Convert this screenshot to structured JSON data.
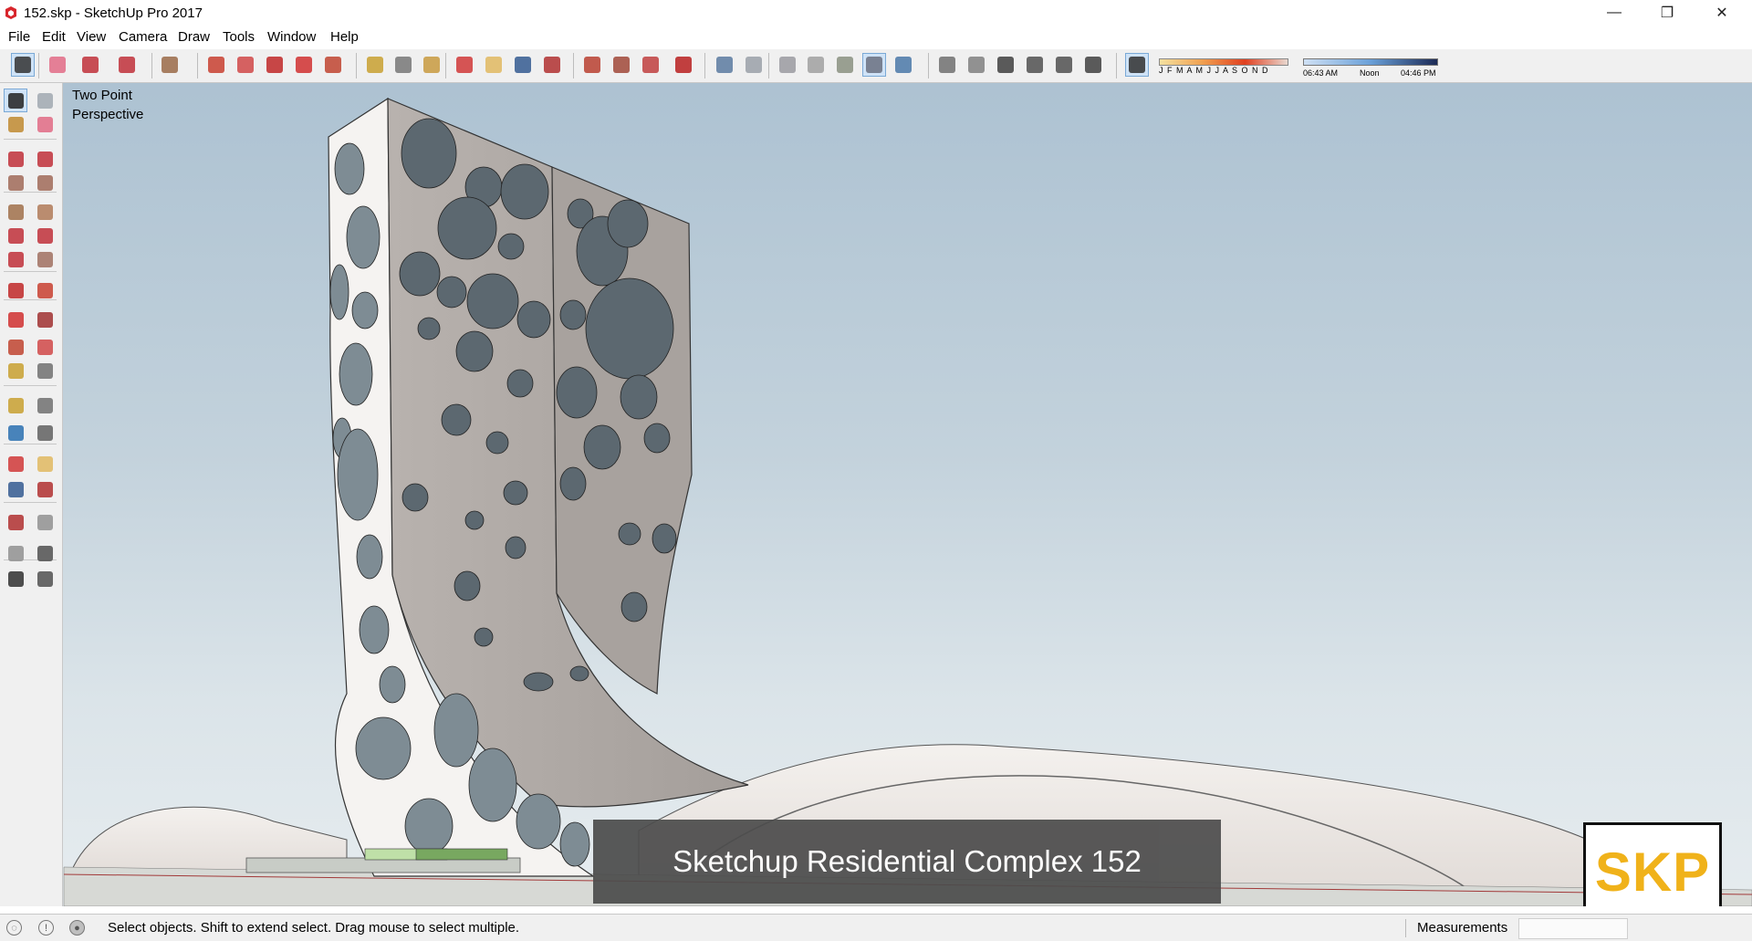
{
  "window": {
    "title": "152.skp - SketchUp Pro 2017",
    "controls": [
      "—",
      "❐",
      "✕"
    ]
  },
  "menu": [
    "File",
    "Edit",
    "View",
    "Camera",
    "Draw",
    "Tools",
    "Window",
    "Help"
  ],
  "toolbar": {
    "tools": [
      {
        "name": "select-tool-icon",
        "color": "#333333",
        "active": true
      },
      {
        "name": "eraser-tool-icon",
        "color": "#e26b86"
      },
      {
        "name": "line-tool-icon",
        "color": "#c0303a"
      },
      {
        "name": "arc-tool-icon",
        "color": "#c0303a"
      },
      {
        "name": "shape-tool-icon",
        "color": "#9a6a48"
      },
      {
        "name": "push-pull-tool-icon",
        "color": "#c84030"
      },
      {
        "name": "follow-me-tool-icon",
        "color": "#d04848"
      },
      {
        "name": "move-tool-icon",
        "color": "#c02828"
      },
      {
        "name": "rotate-tool-icon",
        "color": "#d03030"
      },
      {
        "name": "scale-tool-icon",
        "color": "#c04430"
      },
      {
        "name": "tape-measure-icon",
        "color": "#c8a030"
      },
      {
        "name": "text-tool-icon",
        "color": "#777777"
      },
      {
        "name": "paint-bucket-icon",
        "color": "#c89a40"
      },
      {
        "name": "orbit-tool-icon",
        "color": "#d03838"
      },
      {
        "name": "pan-tool-icon",
        "color": "#e0b860"
      },
      {
        "name": "zoom-tool-icon",
        "color": "#345a90"
      },
      {
        "name": "zoom-extents-icon",
        "color": "#b03030"
      },
      {
        "name": "warehouse-icon",
        "color": "#b84030"
      },
      {
        "name": "share-model-icon",
        "color": "#a04838"
      },
      {
        "name": "extension-warehouse-icon",
        "color": "#c04040"
      },
      {
        "name": "ruby-console-icon",
        "color": "#b82020"
      },
      {
        "name": "xray-style-icon",
        "color": "#5a7aa0"
      },
      {
        "name": "backedges-style-icon",
        "color": "#9aa0a8"
      },
      {
        "name": "wireframe-style-icon",
        "color": "#9a9aa0"
      },
      {
        "name": "hidden-line-style-icon",
        "color": "#a0a0a0"
      },
      {
        "name": "shaded-style-icon",
        "color": "#8a9080"
      },
      {
        "name": "shaded-textures-style-icon",
        "color": "#6a7080",
        "active": true
      },
      {
        "name": "monochrome-style-icon",
        "color": "#4a78a8"
      },
      {
        "name": "iso-view-icon",
        "color": "#707070"
      },
      {
        "name": "top-view-icon",
        "color": "#808080"
      },
      {
        "name": "front-view-icon",
        "color": "#404040"
      },
      {
        "name": "right-view-icon",
        "color": "#505050"
      },
      {
        "name": "back-view-icon",
        "color": "#505050"
      },
      {
        "name": "left-view-icon",
        "color": "#404040"
      },
      {
        "name": "shadows-toggle-icon",
        "color": "#303030",
        "active": true
      }
    ],
    "months": "J F M A M J J A S O N D",
    "time_start": "06:43 AM",
    "time_mid": "Noon",
    "time_end": "04:46 PM"
  },
  "left_tools": [
    {
      "name": "select-icon",
      "color": "#222222",
      "active": true
    },
    {
      "name": "make-component-icon",
      "color": "#a0a8b0"
    },
    {
      "name": "paint-bucket-icon",
      "color": "#c08a30"
    },
    {
      "name": "eraser-icon",
      "color": "#e06a84"
    },
    {
      "name": "line-icon",
      "color": "#c0303a"
    },
    {
      "name": "freehand-icon",
      "color": "#c0303a"
    },
    {
      "name": "rectangle-icon",
      "color": "#a06a58"
    },
    {
      "name": "rotated-rectangle-icon",
      "color": "#a06a58"
    },
    {
      "name": "circle-icon",
      "color": "#a0704a"
    },
    {
      "name": "polygon-icon",
      "color": "#b07a58"
    },
    {
      "name": "arc-icon",
      "color": "#c0303a"
    },
    {
      "name": "two-point-arc-icon",
      "color": "#c0303a"
    },
    {
      "name": "three-point-arc-icon",
      "color": "#c0303a"
    },
    {
      "name": "pie-icon",
      "color": "#a07060"
    },
    {
      "name": "move-icon",
      "color": "#c02828"
    },
    {
      "name": "push-pull-icon",
      "color": "#c84030"
    },
    {
      "name": "rotate-icon",
      "color": "#d03030"
    },
    {
      "name": "follow-me-icon",
      "color": "#a03030"
    },
    {
      "name": "scale-icon",
      "color": "#c04430"
    },
    {
      "name": "offset-icon",
      "color": "#d04848"
    },
    {
      "name": "tape-measure-icon",
      "color": "#c8a030"
    },
    {
      "name": "dimension-icon",
      "color": "#707070"
    },
    {
      "name": "protractor-icon",
      "color": "#c8a030"
    },
    {
      "name": "text-icon",
      "color": "#707070"
    },
    {
      "name": "axes-icon",
      "color": "#2a70b0"
    },
    {
      "name": "3d-text-icon",
      "color": "#606060"
    },
    {
      "name": "orbit-icon",
      "color": "#d03838"
    },
    {
      "name": "pan-icon",
      "color": "#e0b860"
    },
    {
      "name": "zoom-icon",
      "color": "#345a90"
    },
    {
      "name": "zoom-window-icon",
      "color": "#b03030"
    },
    {
      "name": "zoom-extents-icon",
      "color": "#b03030"
    },
    {
      "name": "previous-view-icon",
      "color": "#909090"
    },
    {
      "name": "position-camera-icon",
      "color": "#909090"
    },
    {
      "name": "look-around-icon",
      "color": "#505050"
    },
    {
      "name": "walk-icon",
      "color": "#303030"
    },
    {
      "name": "section-plane-icon",
      "color": "#505050"
    }
  ],
  "viewport": {
    "camera_label_line1": "Two Point",
    "camera_label_line2": "Perspective",
    "caption": "Sketchup Residential Complex 152",
    "logo": "SKP"
  },
  "status": {
    "message": "Select objects. Shift to extend select. Drag mouse to select multiple.",
    "measurements_label": "Measurements",
    "measurements_value": ""
  }
}
